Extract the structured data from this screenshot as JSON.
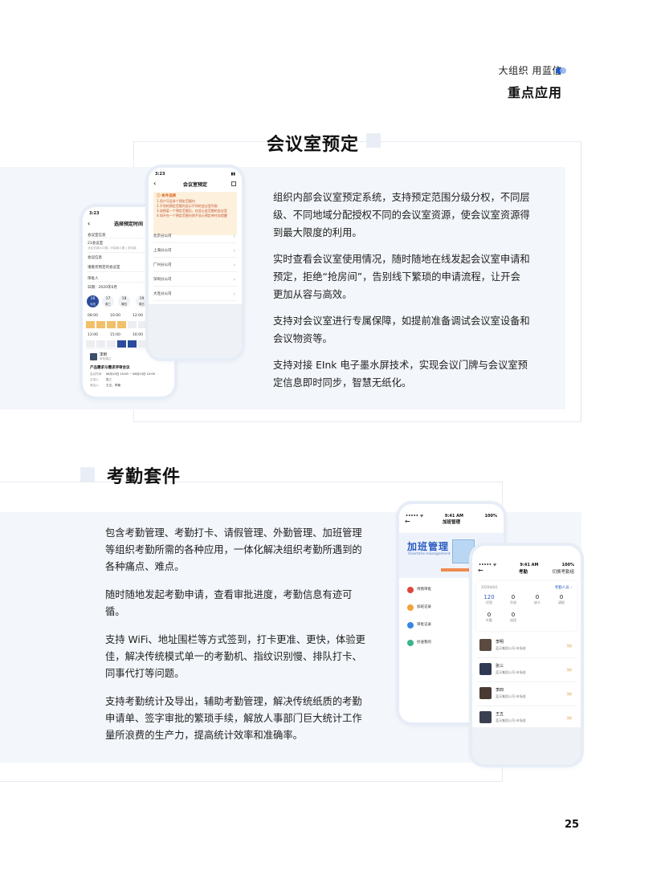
{
  "header": {
    "brand": "大组织 用蓝信",
    "section": "重点应用"
  },
  "meeting": {
    "title": "会议室预定",
    "paragraphs": [
      "组织内部会议室预定系统，支持预定范围分级分权，不同层级、不同地域分配授权不同的会议室资源，使会议室资源得到最大限度的利用。",
      "实时查看会议室使用情况，随时随地在线发起会议室申请和预定，拒绝“抢房间”，告别线下繁琐的申请流程，让开会更加从容与高效。",
      "支持对会议室进行专属保障，如提前准备调试会议室设备和会议物资等。",
      "支持对接 EInk 电子墨水屏技术，实现会议门牌与会议室预定信息即时同步，智慧无纸化。"
    ],
    "phone_back": {
      "time": "3:23",
      "title": "选择预定时间",
      "back": "‹",
      "rows": [
        "会议室信息",
        "21会议室",
        "北京总部A12楼 | 可容纳人数 | 多功能",
        "会议信息",
        "诸葛亮预定的会议室",
        "审批人",
        "日期：2020年6月"
      ],
      "dates": [
        {
          "d": "16",
          "w": "今天"
        },
        {
          "d": "17",
          "w": "周三"
        },
        {
          "d": "18",
          "w": "周四"
        },
        {
          "d": "19",
          "w": "周五"
        }
      ],
      "times": [
        "08:00",
        "10:00",
        "12:00",
        "13:00",
        "15:00",
        "16:00"
      ],
      "card": {
        "name": "李明",
        "role": "审批通过",
        "subject": "产品需求与需求评审会议",
        "rows": [
          {
            "k": "会议时间",
            "v": "06月10日 10:00 ~ 06月10日 10:00"
          },
          {
            "k": "主持人",
            "v": "张三"
          },
          {
            "k": "参会人",
            "v": "王五，李楠"
          }
        ]
      }
    },
    "phone_front": {
      "time": "3:23",
      "title": "会议室预定",
      "back": "‹",
      "notice_title": "ⓘ 条件选择",
      "notice_lines": [
        "1.用户可设多个预定范围内",
        "2.不同的预定范围内显示不同的会议室列表",
        "3.选择某一个预定范围后，仅显示此范围的会议室",
        "4.如不在一个预定范围内则不显示预定单任务提醒"
      ],
      "branches": [
        "北京分公司",
        "上海分公司",
        "广州分公司",
        "深圳分公司",
        "大连分公司"
      ]
    }
  },
  "attendance": {
    "title": "考勤套件",
    "paragraphs": [
      "包含考勤管理、考勤打卡、请假管理、外勤管理、加班管理等组织考勤所需的各种应用，一体化解决组织考勤所遇到的各种痛点、难点。",
      "随时随地发起考勤申请，查看审批进度，考勤信息有迹可循。",
      "支持 WiFi、地址围栏等方式签到，打卡更准、更快，体验更佳，解决传统模式单一的考勤机、指纹识别慢、排队打卡、同事代打等问题。",
      "支持考勤统计及导出，辅助考勤管理，解决传统纸质的考勤申请单、签字审批的繁琐手续，解放人事部门巨大统计工作量所浪费的生产力，提高统计效率和准确率。"
    ],
    "phone_back": {
      "carrier": "••••• ᯤ",
      "time": "9:41 AM",
      "battery": "100%",
      "title": "加班管理",
      "banner": "加班管理",
      "banner_sub": "Overtime management",
      "menu": [
        {
          "label": "待我审批",
          "color": "#e0463c"
        },
        {
          "label": "加班记录",
          "color": "#f2a33a"
        },
        {
          "label": "审批记录",
          "color": "#3a86e0"
        },
        {
          "label": "抄送我的",
          "color": "#3bb58a"
        }
      ]
    },
    "phone_front": {
      "carrier": "••••• ᯤ",
      "time": "9:41 AM",
      "battery": "100%",
      "title": "考勤",
      "switch": "切换考勤组",
      "month": "2020年8月",
      "people_link": "考勤人员 ›",
      "stats": [
        {
          "n": "120",
          "l": "迟到"
        },
        {
          "n": "0",
          "l": "早退"
        },
        {
          "n": "0",
          "l": "缺卡"
        },
        {
          "n": "0",
          "l": "请假"
        },
        {
          "n": "0",
          "l": "外勤"
        },
        {
          "n": "0",
          "l": "加班"
        }
      ],
      "people": [
        {
          "name": "李明",
          "company": "蓝天集团公司-市场部",
          "count": "3次"
        },
        {
          "name": "张三",
          "company": "蓝天集团公司-市场部",
          "count": "3次"
        },
        {
          "name": "李四",
          "company": "蓝天集团公司-市场部",
          "count": "3次"
        },
        {
          "name": "王五",
          "company": "蓝天集团公司-市场部",
          "count": "3次"
        }
      ]
    }
  },
  "page_number": "25"
}
